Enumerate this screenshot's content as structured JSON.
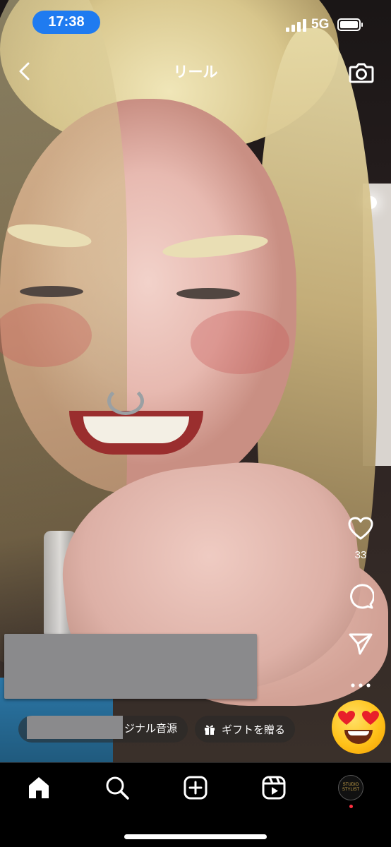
{
  "status_bar": {
    "time": "17:38",
    "network": "5G"
  },
  "header": {
    "title": "リール",
    "back_icon": "chevron-left-icon",
    "camera_icon": "camera-icon"
  },
  "actions": {
    "like_count": "33",
    "like_icon": "heart-icon",
    "comment_icon": "comment-icon",
    "share_icon": "send-icon",
    "more_icon": "more-icon"
  },
  "bottom": {
    "audio_label": "ジナル音源",
    "gift_label": "ギフトを贈る",
    "emoji": "heart-eyes-emoji"
  },
  "profile_avatar_text": "STUDIO STYLIST",
  "tabs": [
    {
      "name": "home",
      "icon": "home-icon"
    },
    {
      "name": "search",
      "icon": "search-icon"
    },
    {
      "name": "create",
      "icon": "plus-square-icon"
    },
    {
      "name": "reels",
      "icon": "reels-icon"
    },
    {
      "name": "profile",
      "icon": "profile-avatar"
    }
  ],
  "colors": {
    "time_pill": "#1f7bf0",
    "notification_dot": "#ff3040"
  }
}
